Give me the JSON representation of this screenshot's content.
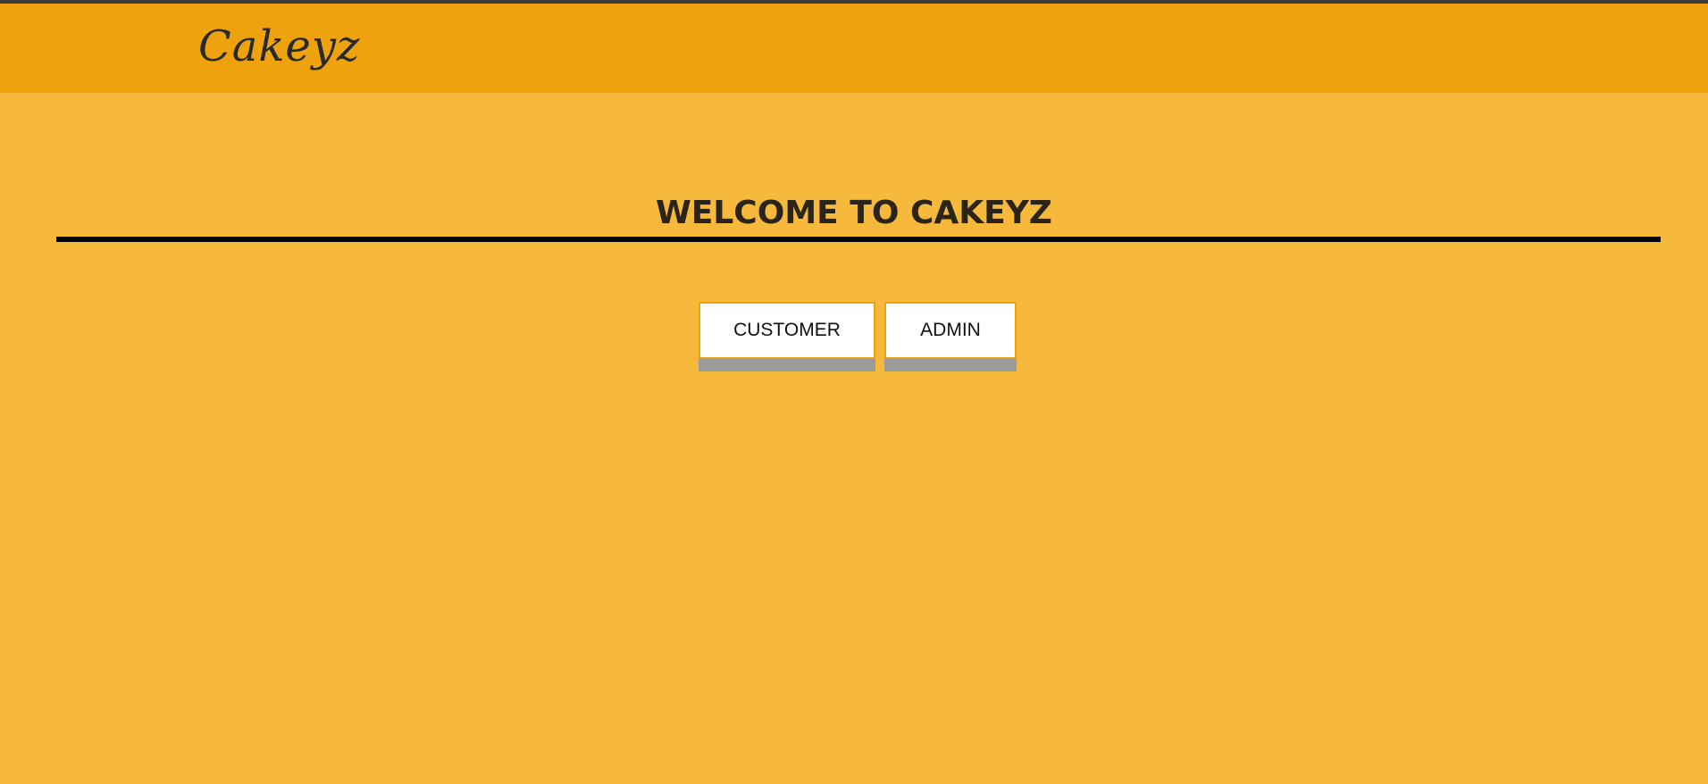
{
  "header": {
    "logo_text": "Cakeyz"
  },
  "main": {
    "welcome_title": "WELCOME TO CAKEYZ",
    "buttons": {
      "customer_label": "CUSTOMER",
      "admin_label": "ADMIN"
    }
  },
  "colors": {
    "background": "#f6b93b",
    "header_bg": "#eea30e",
    "button_bg": "#ffffff",
    "button_border": "#eea30e",
    "button_shadow": "#9b9b9b",
    "rule": "#000000"
  }
}
